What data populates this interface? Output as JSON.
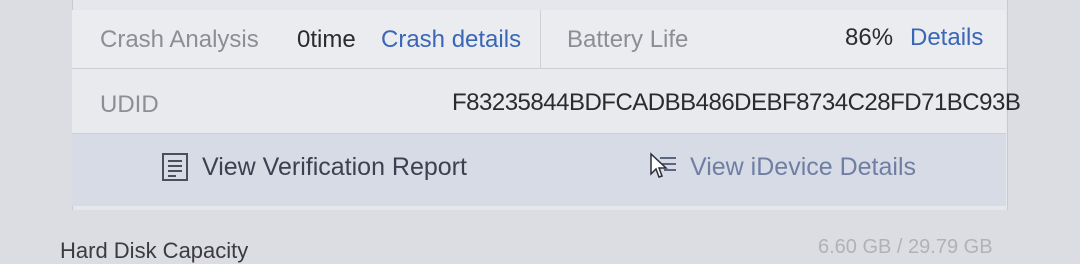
{
  "row1": {
    "crash_label": "Crash Analysis",
    "crash_value": "0time",
    "crash_link": "Crash details",
    "battery_label": "Battery Life",
    "battery_value": "86%",
    "battery_link": "Details"
  },
  "row2": {
    "udid_label": "UDID",
    "udid_value": "F83235844BDFCADBB486DEBF8734C28FD71BC93B"
  },
  "actions": {
    "verification_report": "View Verification Report",
    "idevice_details": "View iDevice Details"
  },
  "footer": {
    "left_label": "Hard Disk Capacity",
    "right_value": "6.60 GB / 29.79 GB"
  },
  "icons": {
    "report": "report-document-icon",
    "details": "device-details-list-icon",
    "cursor": "mouse-pointer-icon"
  }
}
